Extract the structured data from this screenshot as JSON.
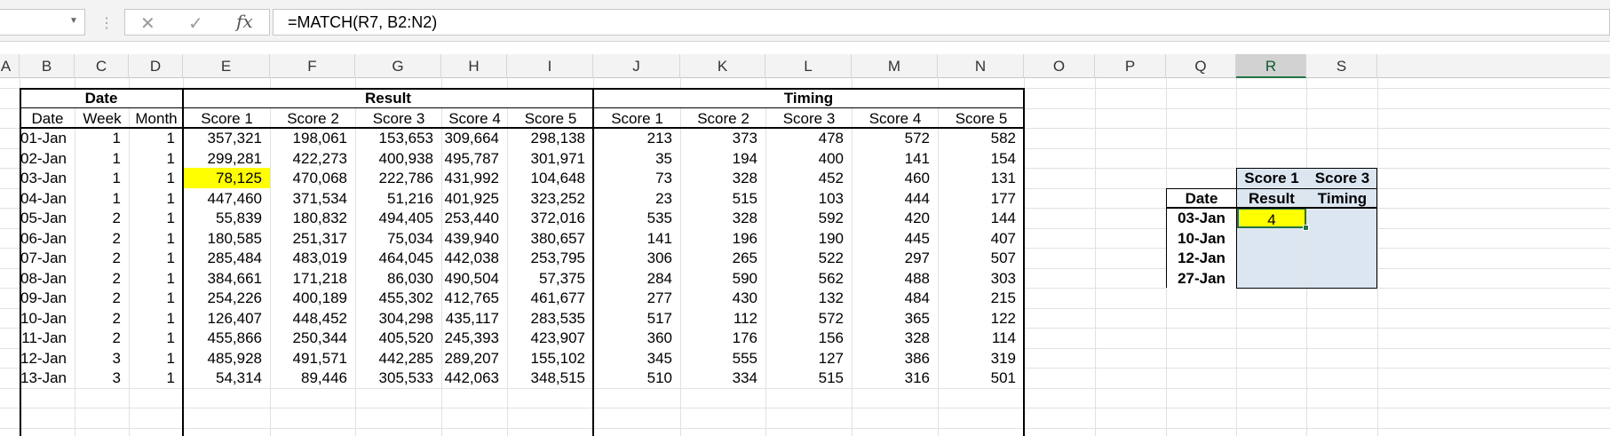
{
  "formula_bar": {
    "name_box": "",
    "cancel_glyph": "✕",
    "enter_glyph": "✓",
    "fx_label": "fx",
    "formula": "=MATCH(R7, B2:N2)"
  },
  "columns": [
    "A",
    "B",
    "C",
    "D",
    "E",
    "F",
    "G",
    "H",
    "I",
    "J",
    "K",
    "L",
    "M",
    "N",
    "O",
    "P",
    "Q",
    "R",
    "S"
  ],
  "selected_column": "R",
  "table": {
    "group_headers": {
      "date": "Date",
      "result": "Result",
      "timing": "Timing"
    },
    "headers": [
      "Date",
      "Week",
      "Month",
      "Score 1",
      "Score 2",
      "Score 3",
      "Score 4",
      "Score 5",
      "Score 1",
      "Score 2",
      "Score 3",
      "Score 4",
      "Score 5"
    ],
    "rows": [
      [
        "01-Jan",
        "1",
        "1",
        "357,321",
        "198,061",
        "153,653",
        "309,664",
        "298,138",
        "213",
        "373",
        "478",
        "572",
        "582"
      ],
      [
        "02-Jan",
        "1",
        "1",
        "299,281",
        "422,273",
        "400,938",
        "495,787",
        "301,971",
        "35",
        "194",
        "400",
        "141",
        "154"
      ],
      [
        "03-Jan",
        "1",
        "1",
        "78,125",
        "470,068",
        "222,786",
        "431,992",
        "104,648",
        "73",
        "328",
        "452",
        "460",
        "131"
      ],
      [
        "04-Jan",
        "1",
        "1",
        "447,460",
        "371,534",
        "51,216",
        "401,925",
        "323,252",
        "23",
        "515",
        "103",
        "444",
        "177"
      ],
      [
        "05-Jan",
        "2",
        "1",
        "55,839",
        "180,832",
        "494,405",
        "253,440",
        "372,016",
        "535",
        "328",
        "592",
        "420",
        "144"
      ],
      [
        "06-Jan",
        "2",
        "1",
        "180,585",
        "251,317",
        "75,034",
        "439,940",
        "380,657",
        "141",
        "196",
        "190",
        "445",
        "407"
      ],
      [
        "07-Jan",
        "2",
        "1",
        "285,484",
        "483,019",
        "464,045",
        "442,038",
        "253,795",
        "306",
        "265",
        "522",
        "297",
        "507"
      ],
      [
        "08-Jan",
        "2",
        "1",
        "384,661",
        "171,218",
        "86,030",
        "490,504",
        "57,375",
        "284",
        "590",
        "562",
        "488",
        "303"
      ],
      [
        "09-Jan",
        "2",
        "1",
        "254,226",
        "400,189",
        "455,302",
        "412,765",
        "461,677",
        "277",
        "430",
        "132",
        "484",
        "215"
      ],
      [
        "10-Jan",
        "2",
        "1",
        "126,407",
        "448,452",
        "304,298",
        "435,117",
        "283,535",
        "517",
        "112",
        "572",
        "365",
        "122"
      ],
      [
        "11-Jan",
        "2",
        "1",
        "455,866",
        "250,344",
        "405,520",
        "245,393",
        "423,907",
        "360",
        "176",
        "156",
        "328",
        "114"
      ],
      [
        "12-Jan",
        "3",
        "1",
        "485,928",
        "491,571",
        "442,285",
        "289,207",
        "155,102",
        "345",
        "555",
        "127",
        "386",
        "319"
      ],
      [
        "13-Jan",
        "3",
        "1",
        "54,314",
        "89,446",
        "305,533",
        "442,063",
        "348,515",
        "510",
        "334",
        "515",
        "316",
        "501"
      ]
    ],
    "highlight_color": "#ffff00"
  },
  "lookup": {
    "header_top": [
      "Score 1",
      "Score 3"
    ],
    "header_bottom": [
      "Date",
      "Result",
      "Timing"
    ],
    "rows": [
      [
        "03-Jan",
        "4",
        ""
      ],
      [
        "10-Jan",
        "",
        ""
      ],
      [
        "12-Jan",
        "",
        ""
      ],
      [
        "27-Jan",
        "",
        ""
      ]
    ],
    "fill_color": "#dce6f1",
    "active_cell_color": "#ffff00",
    "active_border_color": "#217346"
  }
}
